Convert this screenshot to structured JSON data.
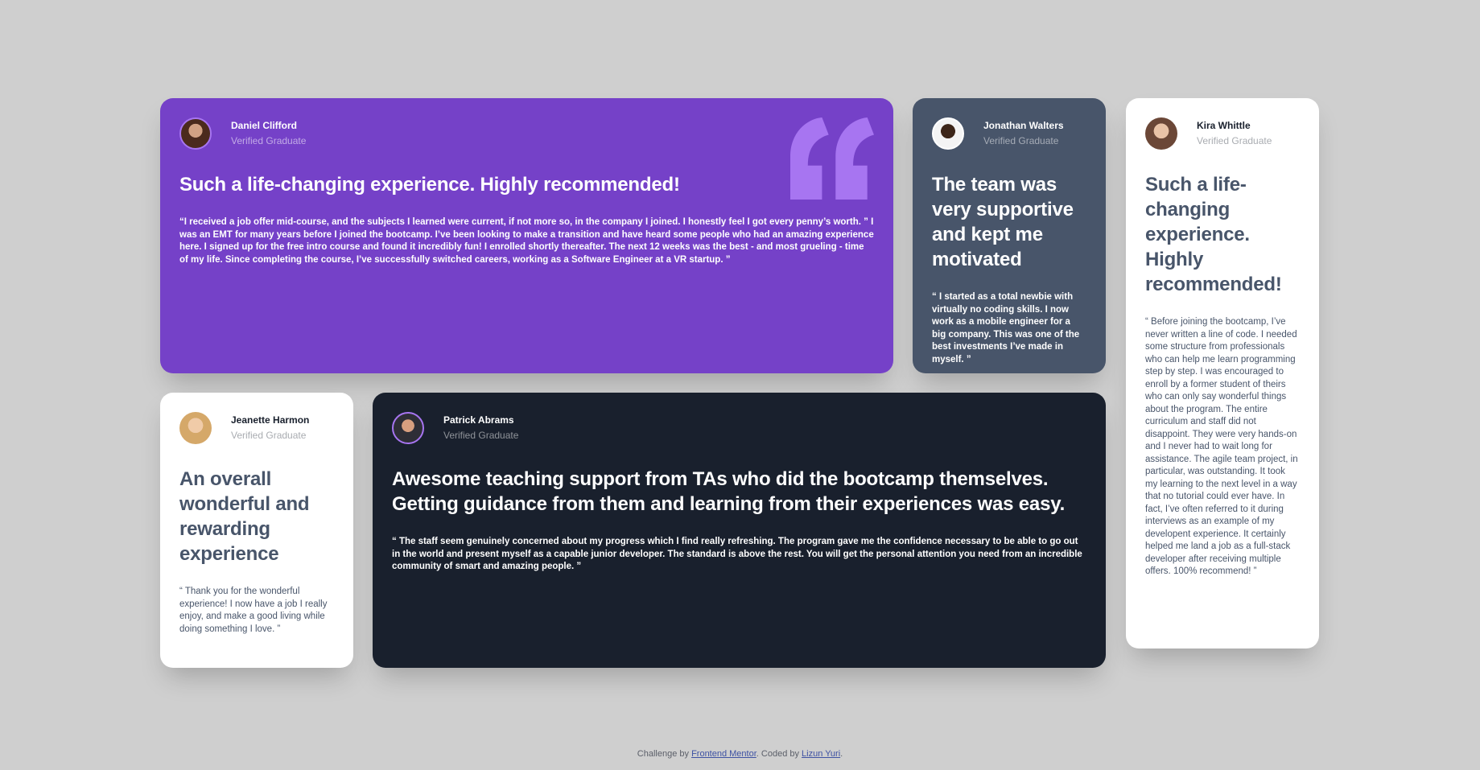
{
  "testimonials": {
    "daniel": {
      "name": "Daniel Clifford",
      "role": "Verified Graduate",
      "headline": "Such a life-changing experience. Highly recommended!",
      "quote": "“I received a job offer mid-course, and the subjects I learned were current, if not more so, in the company I joined. I honestly feel I got every penny’s worth. ” I was an EMT for many years before I joined the bootcamp. I’ve been looking to make a transition and have heard some people who had an amazing experience here. I signed up for the free intro course and found it incredibly fun! I enrolled shortly thereafter. The next 12 weeks was the best - and most grueling - time of my life. Since completing the course, I’ve successfully switched careers, working as a Software Engineer at a VR startup. ”"
    },
    "jonathan": {
      "name": "Jonathan Walters",
      "role": "Verified Graduate",
      "headline": "The team was very supportive and kept me motivated",
      "quote": "“ I started as a total newbie with virtually no coding skills. I now work as a mobile engineer for a big company. This was one of the best investments I’ve made in myself. ”"
    },
    "kira": {
      "name": "Kira Whittle",
      "role": "Verified Graduate",
      "headline": "Such a life-changing experience. Highly recommended!",
      "quote": "“ Before joining the bootcamp, I’ve never written a line of code. I needed some structure from professionals who can help me learn programming step by step. I was encouraged to enroll by a former student of theirs who can only say wonderful things about the program. The entire curriculum and staff did not disappoint. They were very hands-on and I never had to wait long for assistance. The agile team project, in particular, was outstanding. It took my learning to the next level in a way that no tutorial could ever have. In fact, I’ve often referred to it during interviews as an example of my developent experience. It certainly helped me land a job as a full-stack developer after receiving multiple offers. 100% recommend! ”"
    },
    "jeanette": {
      "name": "Jeanette Harmon",
      "role": "Verified Graduate",
      "headline": "An overall wonderful and rewarding experience",
      "quote": "“ Thank you for the wonderful experience! I now have a job I really enjoy, and make a good living while doing something I love. ”"
    },
    "patrick": {
      "name": "Patrick Abrams",
      "role": "Verified Graduate",
      "headline": "Awesome teaching support from TAs who did the bootcamp themselves. Getting guidance from them and learning from their experiences was easy.",
      "quote": "“ The staff seem genuinely concerned about my progress which I find really refreshing. The program gave me the confidence necessary to be able to go out in the world and present myself as a capable junior developer. The standard is above the rest. You will get the personal attention you need from an incredible community of smart and amazing people. ”"
    }
  },
  "icons": {
    "quote_mark": "quote-mark-icon",
    "avatar": "avatar"
  },
  "footer": {
    "challenge_prefix": "Challenge by",
    "challenge_link": "Frontend Mentor",
    "coded_prefix": ". Coded by",
    "coded_link": "Lizun Yuri",
    "suffix": "."
  },
  "colors": {
    "background": "#cfcfcf",
    "purple": "#7541c8",
    "grayish_blue": "#48556a",
    "dark": "#19202d",
    "white": "#ffffff",
    "light_purple": "#a775f1"
  }
}
